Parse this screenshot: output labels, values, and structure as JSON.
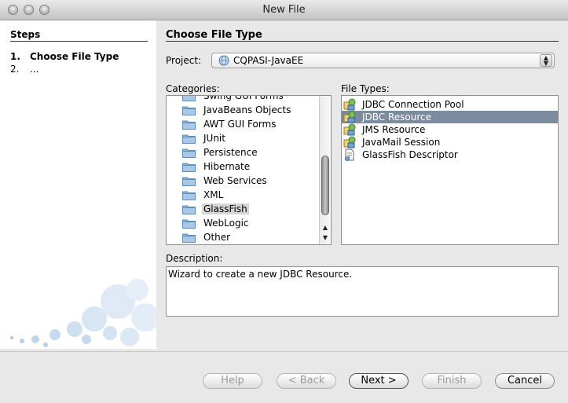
{
  "window": {
    "title": "New File"
  },
  "steps": {
    "header": "Steps",
    "items": [
      {
        "num": "1.",
        "label": "Choose File Type",
        "current": true
      },
      {
        "num": "2.",
        "label": "...",
        "current": false
      }
    ]
  },
  "main": {
    "section_title": "Choose File Type",
    "project": {
      "label": "Project:",
      "value": "CQPASI-JavaEE"
    },
    "categories": {
      "label": "Categories:",
      "items": [
        "Swing GUI Forms",
        "JavaBeans Objects",
        "AWT GUI Forms",
        "JUnit",
        "Persistence",
        "Hibernate",
        "Web Services",
        "XML",
        "GlassFish",
        "WebLogic",
        "Other"
      ],
      "selected": "GlassFish"
    },
    "file_types": {
      "label": "File Types:",
      "items": [
        "JDBC Connection Pool",
        "JDBC Resource",
        "JMS Resource",
        "JavaMail Session",
        "GlassFish Descriptor"
      ],
      "selected": "JDBC Resource"
    },
    "description": {
      "label": "Description:",
      "text": "Wizard to create a new JDBC Resource."
    }
  },
  "buttons": {
    "help": "Help",
    "back": "< Back",
    "next": "Next >",
    "finish": "Finish",
    "cancel": "Cancel"
  },
  "icons": {
    "category": "folder-icon",
    "file_type": "glassfish-resource-icon",
    "descriptor": "descriptor-file-icon",
    "project": "globe-icon"
  },
  "colors": {
    "selection": "#7d8ba1",
    "folder": "#8ab4d8"
  }
}
